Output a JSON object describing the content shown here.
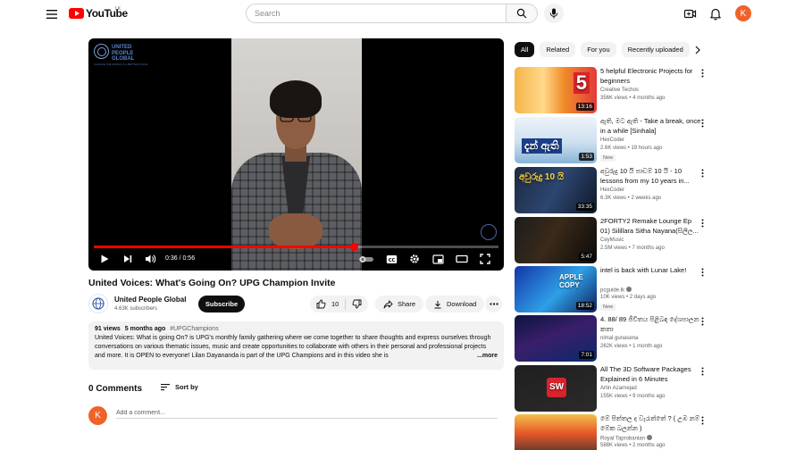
{
  "header": {
    "logo_text": "YouTube",
    "logo_country": "LK",
    "search_placeholder": "Search",
    "avatar_letter": "K",
    "icons": [
      "menu-icon",
      "search-icon",
      "mic-icon",
      "create-icon",
      "bell-icon"
    ]
  },
  "player": {
    "current_time": "0:36",
    "duration": "0:56",
    "time_display": "0:36 / 0:56",
    "progress_fraction": 0.643,
    "overlay_logo": [
      "UNITED",
      "PEOPLE",
      "GLOBAL"
    ],
    "overlay_tagline": "CHANGE THE WORLD & A BETTER PLACE",
    "controls": [
      "play-icon",
      "next-icon",
      "volume-icon",
      "autoplay-toggle",
      "captions-icon",
      "settings-icon",
      "miniplayer-icon",
      "theater-icon",
      "fullscreen-icon"
    ]
  },
  "video": {
    "title": "United Voices: What's Going On? UPG Champion Invite",
    "channel_name": "United People Global",
    "subscribers": "4.63K subscribers",
    "subscribe_label": "Subscribe",
    "like_count": "10",
    "share_label": "Share",
    "download_label": "Download"
  },
  "description": {
    "views": "91 views",
    "age": "5 months ago",
    "hashtag": "#UPGChampions",
    "text": "United Voices: What is going On? is UPG's monthly family gathering where we come together to share thoughts and express ourselves through conversations on various thematic issues, music and create opportunities to collaborate with others in their personal and professional projects and more. It is OPEN to everyone! Lilan Dayananda is part of the UPG Champions and in this video she is",
    "more_label": "...more"
  },
  "comments": {
    "title": "0 Comments",
    "sort_label": "Sort by",
    "avatar_letter": "K",
    "placeholder": "Add a comment..."
  },
  "chips": [
    {
      "label": "All",
      "active": true
    },
    {
      "label": "Related",
      "active": false
    },
    {
      "label": "For you",
      "active": false
    },
    {
      "label": "Recently uploaded",
      "active": false
    }
  ],
  "recommendations": [
    {
      "title": "5 helpful Electronic Projects for beginners",
      "channel": "Creative Techos",
      "verified": false,
      "meta": "356K views • 4 months ago",
      "duration": "13:16",
      "badge": "",
      "thumb_text": "5"
    },
    {
      "title": "ඇති, මට ඇති - Take a break, once in a while [Sinhala]",
      "channel": "HexCoder",
      "verified": false,
      "meta": "2.6K views • 19 hours ago",
      "duration": "1:53",
      "badge": "New",
      "thumb_text": "දැන් ඇති"
    },
    {
      "title": "අවුරුදු 10 යි පාඩම් 10 යි - 10 lessons from my 10 years in...",
      "channel": "HexCoder",
      "verified": false,
      "meta": "6.3K views • 2 weeks ago",
      "duration": "33:35",
      "badge": "",
      "thumb_text": "අවුරුදු 10 යි"
    },
    {
      "title": "2FORTY2 Remake Lounge Ep 01) Silillara Sitha Nayana(සිලිල...",
      "channel": "CeyMusic",
      "verified": false,
      "meta": "2.5M views • 7 months ago",
      "duration": "5:47",
      "badge": "",
      "thumb_text": ""
    },
    {
      "title": "intel is back with Lunar Lake!",
      "channel": "pcguide.lk",
      "verified": true,
      "meta": "10K views • 2 days ago",
      "duration": "18:52",
      "badge": "New",
      "thumb_text": "APPLE COPY"
    },
    {
      "title": "4. 88/ 89 ජීවිතය පිළිබඳ දේශපාලන කතා",
      "channel": "nimal gunasena",
      "verified": false,
      "meta": "262K views • 1 month ago",
      "duration": "7:01",
      "badge": "",
      "thumb_text": ""
    },
    {
      "title": "All The 3D Software Packages Explained in 6 Minutes",
      "channel": "Artin Azarnejad",
      "verified": false,
      "meta": "155K views • 9 months ago",
      "duration": "",
      "badge": "",
      "thumb_text": "SW"
    },
    {
      "title": "මේ පිත්තල ද වැරැත්තේ ? ( උඹ නම් මේක බලන්න )",
      "channel": "Royal Taprobanian",
      "verified": true,
      "meta": "588K views • 2 months ago",
      "duration": "",
      "badge": "",
      "thumb_text": ""
    }
  ]
}
